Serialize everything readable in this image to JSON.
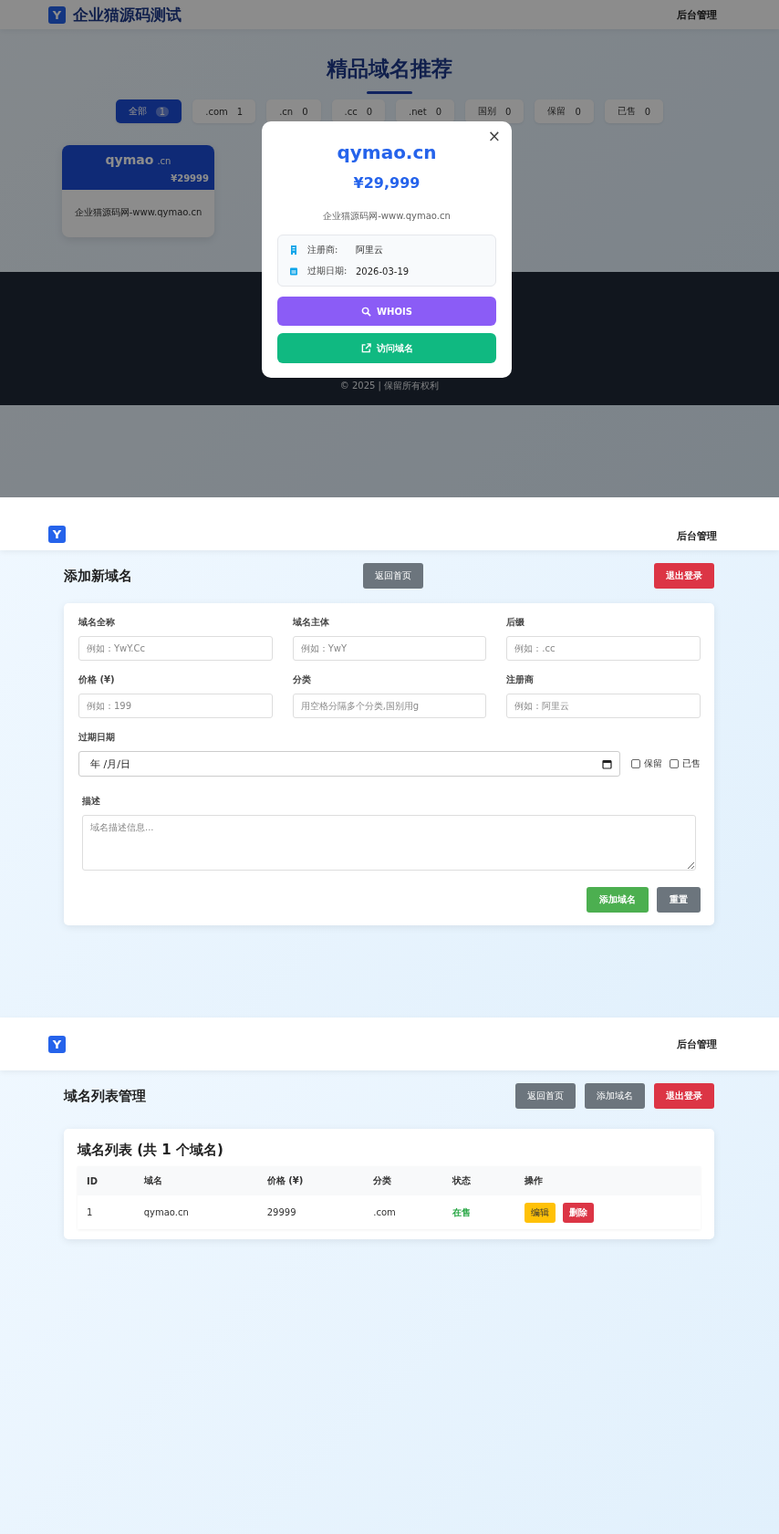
{
  "home_screen": {
    "header": {
      "logo": "Y",
      "site_name": "企业猫源码测试",
      "nav": "后台管理"
    },
    "heading": "精品域名推荐",
    "filters": [
      {
        "label": "全部",
        "count": "1",
        "selected": true
      },
      {
        "label": ".com",
        "count": "1",
        "selected": false
      },
      {
        "label": ".cn",
        "count": "0",
        "selected": false
      },
      {
        "label": ".cc",
        "count": "0",
        "selected": false
      },
      {
        "label": ".net",
        "count": "0",
        "selected": false
      },
      {
        "label": "国别",
        "count": "0",
        "selected": false
      },
      {
        "label": "保留",
        "count": "0",
        "selected": false
      },
      {
        "label": "已售",
        "count": "0",
        "selected": false
      }
    ],
    "domain_cards": [
      {
        "name": "qymao",
        "suffix": ".cn",
        "price": "¥29999",
        "description": "企业猫源码网-www.qymao.cn"
      }
    ],
    "footer": {
      "copyright": "© 2025 | 保留所有权利"
    },
    "modal": {
      "close": "×",
      "domain": "qymao.cn",
      "price": "¥29,999",
      "description": "企业猫源码网-www.qymao.cn",
      "details": [
        {
          "kind": "registrar",
          "label": "注册商:",
          "value": "阿里云"
        },
        {
          "kind": "date",
          "label": "过期日期:",
          "value": "2026-03-19"
        }
      ],
      "buttons": [
        {
          "kind": "whois",
          "label": "WHOIS"
        },
        {
          "kind": "visit",
          "label": "访问域名"
        }
      ]
    }
  },
  "add_screen": {
    "header": {
      "logo": "Y",
      "nav": "后台管理"
    },
    "title": "添加新域名",
    "buttons": [
      {
        "kind": "secondary",
        "label": "返回首页"
      },
      {
        "kind": "danger",
        "label": "退出登录"
      }
    ],
    "fields": [
      {
        "label": "域名全称",
        "placeholder": "例如：YwY.Cc"
      },
      {
        "label": "域名主体",
        "placeholder": "例如：YwY"
      },
      {
        "label": "后缀",
        "placeholder": "例如：.cc"
      },
      {
        "label": "价格 (¥)",
        "placeholder": "例如：199"
      },
      {
        "label": "分类",
        "placeholder": "用空格分隔多个分类,国别用g"
      },
      {
        "label": "注册商",
        "placeholder": "例如：阿里云"
      }
    ],
    "date_field": {
      "label": "过期日期",
      "placeholder": "年 /月/日"
    },
    "checkboxes": [
      {
        "label": "保留",
        "checked": false
      },
      {
        "label": "已售",
        "checked": false
      }
    ],
    "description": {
      "label": "描述",
      "placeholder": "域名描述信息..."
    },
    "actions": [
      {
        "kind": "success",
        "label": "添加域名"
      },
      {
        "kind": "secondary",
        "label": "重置"
      }
    ]
  },
  "list_screen": {
    "header": {
      "logo": "Y",
      "nav": "后台管理"
    },
    "title": "域名列表管理",
    "buttons": [
      {
        "kind": "secondary",
        "label": "返回首页"
      },
      {
        "kind": "secondary",
        "label": "添加域名"
      },
      {
        "kind": "danger",
        "label": "退出登录"
      }
    ],
    "table_title": "域名列表 (共 1 个域名)",
    "table": {
      "columns": [
        "ID",
        "域名",
        "价格 (¥)",
        "分类",
        "状态",
        "操作"
      ],
      "rows": [
        {
          "id": "1",
          "domain": "qymao.cn",
          "price": "29999",
          "category": ".com",
          "status": "在售",
          "for_sale": true,
          "actions": [
            {
              "kind": "warning",
              "label": "编辑"
            },
            {
              "kind": "danger",
              "label": "删除"
            }
          ]
        }
      ]
    }
  }
}
